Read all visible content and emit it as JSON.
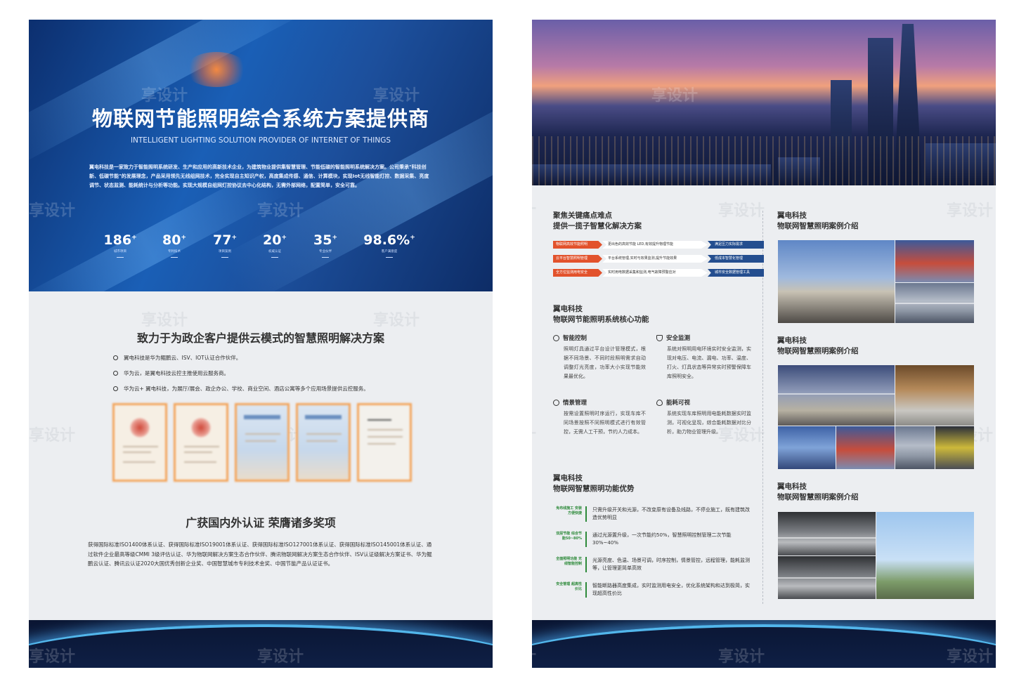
{
  "watermark": "享设计",
  "left": {
    "hero": {
      "title": "物联网节能照明综合系统方案提供商",
      "subtitle": "INTELLIGENT LIGHTING SOLUTION PROVIDER OF INTERNET OF THINGS",
      "intro": "翼电科技是一家致力于智能照明系统研发、生产和应用的高新技术企业，为建筑物业提供集智慧管理、节能低碳的智能照明系统解决方案。公司秉承\"科技创新、低碳节能\"的发展理念，产品采用领先无线组网技术，完全实现自主知识产权，高度集成传感、通信、计算模块，实现Iot无线智能灯控、数据采集、亮度调节、状态监测、能耗统计与分析等功能。实现大规模自组网灯控协议去中心化结构，无需外部网络，配置简单，安全可靠。",
      "stats": [
        {
          "value": "186",
          "suffix": "+",
          "label": "城市项目"
        },
        {
          "value": "80",
          "suffix": "+",
          "label": "专利技术"
        },
        {
          "value": "77",
          "suffix": "+",
          "label": "项目案例"
        },
        {
          "value": "20",
          "suffix": "+",
          "label": "权威认证"
        },
        {
          "value": "35",
          "suffix": "+",
          "label": "专业伙伴"
        },
        {
          "value": "98.6%",
          "suffix": "+",
          "label": "客户满意度"
        }
      ]
    },
    "solution_heading": "致力于为政企客户提供云模式的智慧照明解决方案",
    "bullets": [
      "翼电科技是华为鲲鹏云、ISV、IOT认证合作伙伴。",
      "华为云，是翼电科技云控主推使用云服务商。",
      "华为云+ 翼电科技，为展厅/展会、政企办公、学校、商业空间、酒店公寓等多个应用场景提供云控服务。"
    ],
    "awards_heading": "广获国内外认证 荣膺诸多奖项",
    "awards_text": "获得国际标准ISO1400体系认证、获得国际标准ISO19001体系认证、获得国际标准ISO127001体系认证、获得国际标准ISO145001体系认证、通过软件企业最高等级CMMI 3级评估认证、华为物联网解决方案生态合作伙伴、腾讯物联网解决方案生态合作伙伴、ISV认证级解决方案证书、华为鲲鹏云认证、腾讯云认证2020大国优秀创新企业奖、中国智慧城市专利技术金奖、中国节能产品认证证书。"
  },
  "right": {
    "pain": {
      "title_line1": "聚焦关键痛点难点",
      "title_line2": "提供一揽子智慧化解决方案",
      "rows": [
        {
          "tag": "物联网高效节能照明",
          "desc": "更出色的高效节能 LED,有效提升物理节能",
          "result": "满足压力实际需求"
        },
        {
          "tag": "云平台智慧照明管理",
          "desc": "平台系统管理,实时与效果监测,提升节能效果",
          "result": "低成本智慧化管理"
        },
        {
          "tag": "全方位监测用电安全",
          "desc": "实时用电数据采集和监测,电气故障预警应对",
          "result": "城市安全数据管理工具"
        }
      ]
    },
    "core": {
      "title_line1": "翼电科技",
      "title_line2": "物联网节能照明系统核心功能",
      "features": [
        {
          "icon": "gear-icon",
          "name": "智能控制",
          "desc": "照明灯具通过平台设计管理模式，根据不同场景、不同时段照明需求自动调整灯光亮度，功率大小实现节能效果最优化。"
        },
        {
          "icon": "shield-icon",
          "name": "安全监测",
          "desc": "系统对照明用电环境实时安全监测，实现对电压、电流、漏电、功率、温度、打火、灯具状态等异常实时预警保障车库照明安全。"
        },
        {
          "icon": "circle-icon",
          "name": "情景管理",
          "desc": "按需设置照明时序运行，实现车库不同场景按照不同照明模式进行有效管控，无需人工干预，节约人力成本。"
        },
        {
          "icon": "eye-icon",
          "name": "能耗可视",
          "desc": "系统实现车库照明用电能耗数据实时监测，可视化呈现，综合能耗数据对比分析，助力物业管理升级。"
        }
      ]
    },
    "advantages": {
      "title_line1": "翼电科技",
      "title_line2": "物联网智慧照明功能优势",
      "rows": [
        {
          "tag": "免布线施工 安装方便快捷",
          "text": "只需升级开关和光源，不改变原有设备及线路，不停业施工，既有建筑改造优势明显"
        },
        {
          "tag": "双层节能 综合节能50~80%",
          "text": "通过光源置升级，一次节能约50%，智慧照明控制管理二次节能30%~40%"
        },
        {
          "tag": "全面照明功能 无线智能控制",
          "text": "光源亮度、色温、场景可调，时序控制，情景管控，远程管理，能耗监测等，让管理更简单高效"
        },
        {
          "tag": "安全管理 超高性价比",
          "text": "智能断路器高度集成，实时监测用电安全，优化系统架构和达到极简，实现超高性价比"
        }
      ]
    },
    "cases": [
      {
        "title_line1": "翼电科技",
        "title_line2": "物联网智慧照明案例介绍"
      },
      {
        "title_line1": "翼电科技",
        "title_line2": "物联网智慧照明案例介绍"
      },
      {
        "title_line1": "翼电科技",
        "title_line2": "物联网智慧照明案例介绍"
      }
    ]
  }
}
